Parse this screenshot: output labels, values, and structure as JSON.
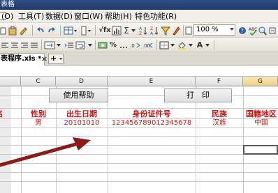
{
  "window": {
    "title": "表格"
  },
  "menu": {
    "items": [
      {
        "id": "close",
        "label": ""
      },
      {
        "id": "o",
        "label": "(O)"
      },
      {
        "id": "tools",
        "label": "工具(T)"
      },
      {
        "id": "data",
        "label": "数据(D)"
      },
      {
        "id": "window",
        "label": "窗口(W)"
      },
      {
        "id": "help",
        "label": "帮助(H)"
      },
      {
        "id": "special",
        "label": "特色功能(R)"
      }
    ]
  },
  "toolbar": {
    "zoom": "100 %",
    "percent_label": "%"
  },
  "tabs": {
    "active_label": "表程序.xls *",
    "close_glyph": "×",
    "new_tab_glyph": "+"
  },
  "sheet": {
    "columns": [
      "C",
      "D",
      "E",
      "F",
      "G"
    ],
    "selected_column": "G",
    "buttons": {
      "help": "使用帮助",
      "print": "打　印"
    },
    "headers": [
      {
        "id": "partial-b",
        "text": "名"
      },
      {
        "id": "gender",
        "text": "性别"
      },
      {
        "id": "birthdate",
        "text": "出生日期"
      },
      {
        "id": "id-number",
        "text": "身份证件号"
      },
      {
        "id": "ethnicity",
        "text": "民族"
      },
      {
        "id": "nationality",
        "text": "国籍地区"
      }
    ],
    "row1": {
      "gender": "男",
      "birthdate": "20101010",
      "id_number": "123456789012345678",
      "ethnicity": "汉族",
      "nationality": "中国"
    }
  },
  "annotation": {
    "arrow_color": "#8b1a1a"
  },
  "colors": {
    "header_red": "#d01414",
    "titlebar": "#2f4f86"
  }
}
